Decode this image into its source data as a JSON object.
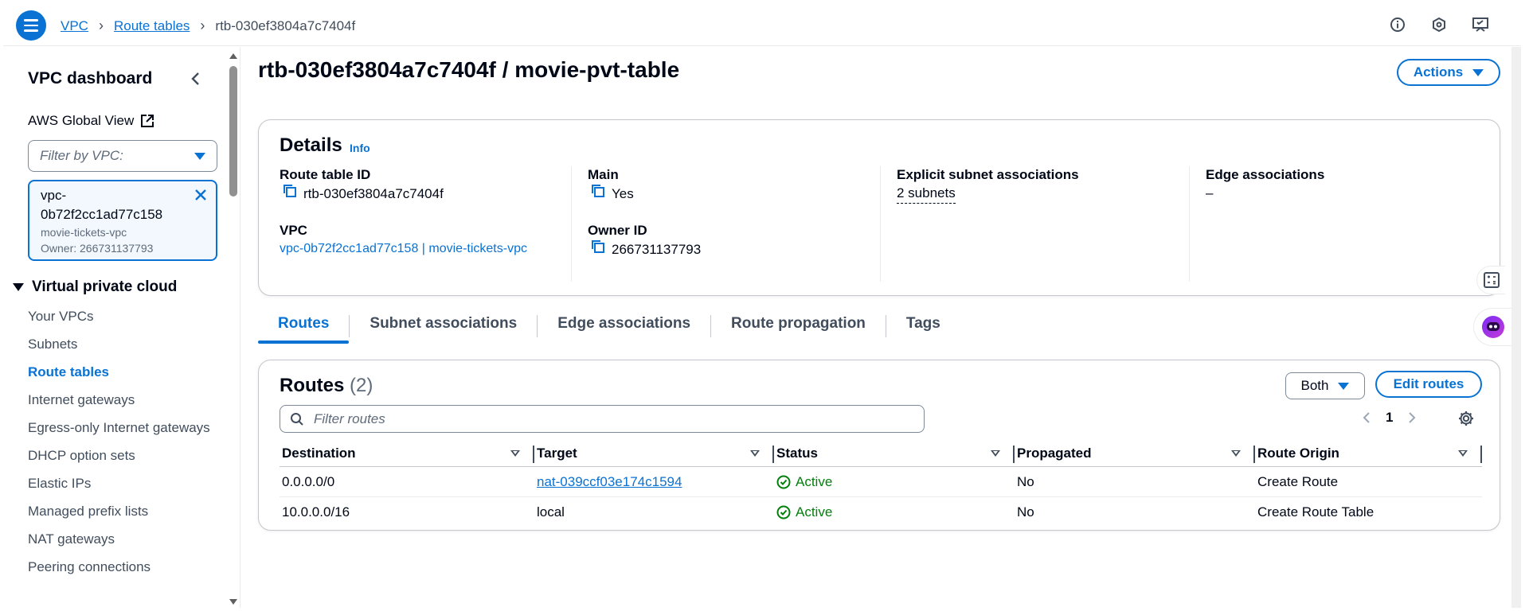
{
  "breadcrumb": {
    "items": [
      "VPC",
      "Route tables"
    ],
    "current": "rtb-030ef3804a7c7404f"
  },
  "sidebar": {
    "title": "VPC dashboard",
    "global_view": "AWS Global View",
    "filter_placeholder": "Filter by VPC:",
    "token": {
      "id": "vpc-0b72f2cc1ad77c158",
      "name": "movie-tickets-vpc",
      "owner": "Owner: 266731137793"
    },
    "section": "Virtual private cloud",
    "items": [
      {
        "label": "Your VPCs"
      },
      {
        "label": "Subnets"
      },
      {
        "label": "Route tables"
      },
      {
        "label": "Internet gateways"
      },
      {
        "label": "Egress-only Internet gateways"
      },
      {
        "label": "DHCP option sets"
      },
      {
        "label": "Elastic IPs"
      },
      {
        "label": "Managed prefix lists"
      },
      {
        "label": "NAT gateways"
      },
      {
        "label": "Peering connections"
      }
    ]
  },
  "page": {
    "title": "rtb-030ef3804a7c7404f / movie-pvt-table",
    "actions_label": "Actions"
  },
  "details": {
    "title": "Details",
    "info": "Info",
    "route_table_id_label": "Route table ID",
    "route_table_id": "rtb-030ef3804a7c7404f",
    "vpc_label": "VPC",
    "vpc_value": "vpc-0b72f2cc1ad77c158 | movie-tickets-vpc",
    "main_label": "Main",
    "main_value": "Yes",
    "owner_label": "Owner ID",
    "owner_value": "266731137793",
    "explicit_label": "Explicit subnet associations",
    "explicit_value": "2 subnets",
    "edge_label": "Edge associations",
    "edge_value": "–"
  },
  "tabs": [
    {
      "label": "Routes"
    },
    {
      "label": "Subnet associations"
    },
    {
      "label": "Edge associations"
    },
    {
      "label": "Route propagation"
    },
    {
      "label": "Tags"
    }
  ],
  "routes": {
    "title": "Routes",
    "count": "(2)",
    "both_label": "Both",
    "edit_label": "Edit routes",
    "search_placeholder": "Filter routes",
    "page": "1",
    "columns": [
      "Destination",
      "Target",
      "Status",
      "Propagated",
      "Route Origin"
    ],
    "rows": [
      {
        "destination": "0.0.0.0/0",
        "target": "nat-039ccf03e174c1594",
        "status": "Active",
        "propagated": "No",
        "origin": "Create Route"
      },
      {
        "destination": "10.0.0.0/16",
        "target": "local",
        "status": "Active",
        "propagated": "No",
        "origin": "Create Route Table"
      }
    ]
  },
  "colors": {
    "accent": "#0972d3",
    "success": "#037f0c",
    "text": "#000716"
  }
}
